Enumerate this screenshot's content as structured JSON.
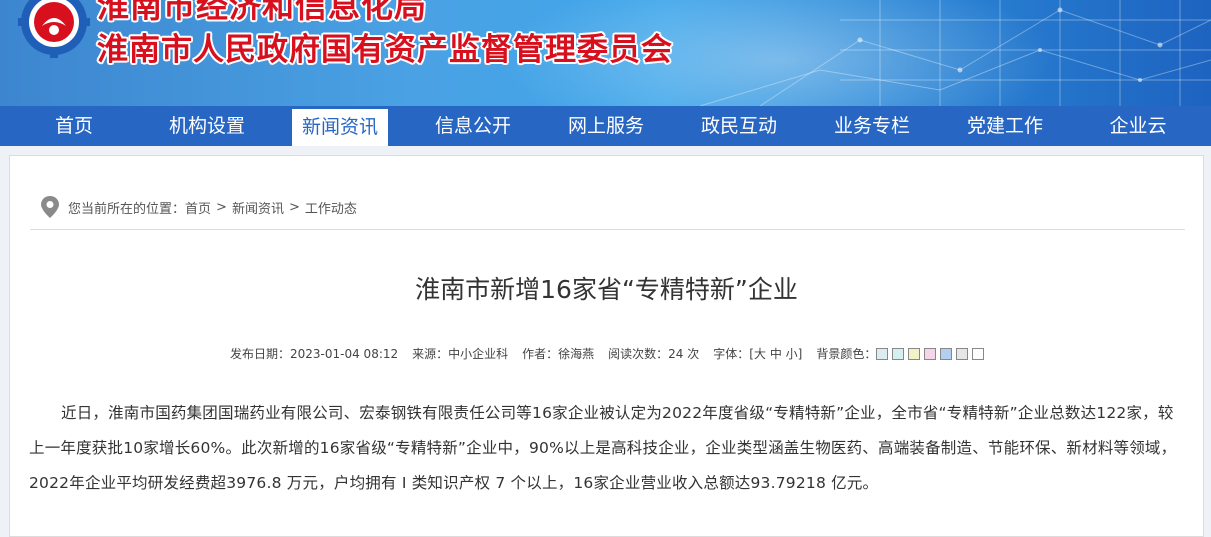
{
  "header": {
    "title_top": "淮南市经济和信息化局",
    "title_main": "淮南市人民政府国有资产监督管理委员会",
    "logo_icon": "gear-emblem-logo",
    "colors": {
      "banner": "#3d86cf",
      "title": "#d8101e",
      "nav": "#2866c4"
    }
  },
  "nav": {
    "items": [
      "首页",
      "机构设置",
      "新闻资讯",
      "信息公开",
      "网上服务",
      "政民互动",
      "业务专栏",
      "党建工作",
      "企业云"
    ],
    "active": "新闻资讯"
  },
  "breadcrumb": {
    "prefix": "您当前所在的位置：",
    "items": [
      "首页",
      "新闻资讯",
      "工作动态"
    ],
    "separator": ">"
  },
  "article": {
    "title": "淮南市新增16家省“专精特新”企业",
    "meta": {
      "date": "发布日期：2023-01-04 08:12",
      "source": "来源：中小企业科",
      "author": "作者：徐海燕",
      "views": "阅读次数：24 次",
      "font_label": "字体：",
      "font_sizes": [
        "大",
        "中",
        "小"
      ],
      "bg_label": "背景颜色：",
      "bg_colors": [
        "#dcecf2",
        "#d5f0f0",
        "#f2f2c8",
        "#f5d5e8",
        "#b3cff0",
        "#e6e6e6",
        "#ffffff"
      ]
    },
    "body": "近日，淮南市国药集团国瑞药业有限公司、宏泰钢铁有限责任公司等16家企业被认定为2022年度省级“专精特新”企业，全市省“专精特新”企业总数达122家，较上一年度获批10家增长60%。此次新增的16家省级“专精特新”企业中，90%以上是高科技企业，企业类型涵盖生物医药、高端装备制造、节能环保、新材料等领域，2022年企业平均研发经费超3976.8 万元，户均拥有 I 类知识产权 7 个以上，16家企业营业收入总额达93.79218 亿元。"
  }
}
